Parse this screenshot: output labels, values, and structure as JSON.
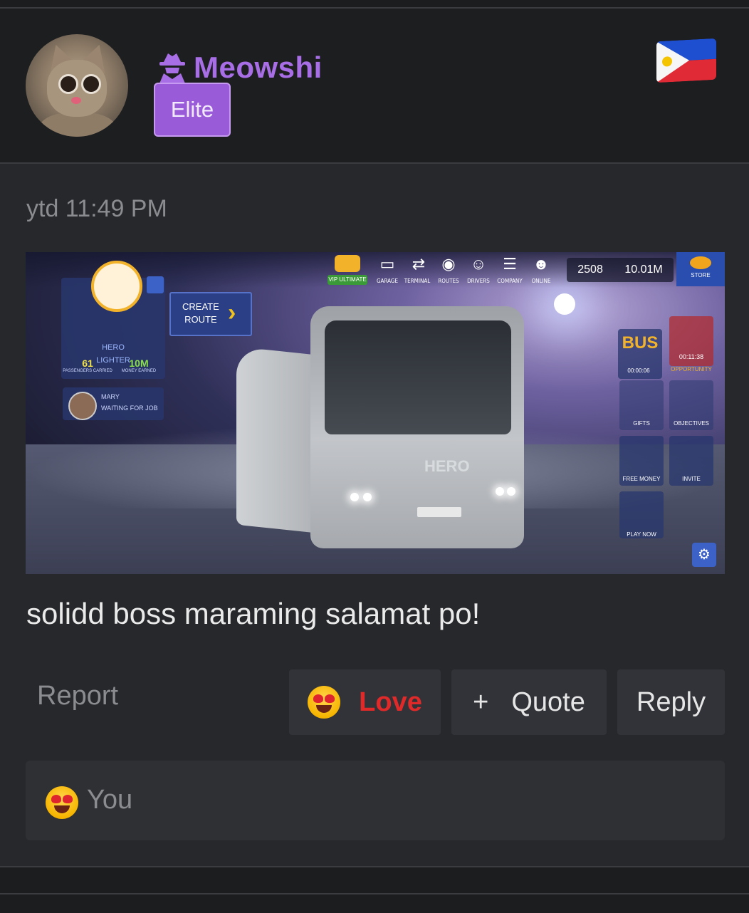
{
  "post": {
    "username": "Meowshi",
    "badge": "Elite",
    "flag": "philippines-flag",
    "timestamp": "ytd 11:49 PM",
    "message": "solidd boss maraming salamat po!"
  },
  "attachment": {
    "top_icons": [
      {
        "icon": "bus-icon",
        "label": "GARAGE"
      },
      {
        "icon": "signpost-icon",
        "label": "TERMINAL"
      },
      {
        "icon": "pin-icon",
        "label": "ROUTES"
      },
      {
        "icon": "driver-icon",
        "label": "DRIVERS"
      },
      {
        "icon": "building-icon",
        "label": "COMPANY"
      },
      {
        "icon": "people-icon",
        "label": "ONLINE"
      }
    ],
    "vip_label": "VIP ULTIMATE",
    "coins": "2508",
    "money": "10.01M",
    "store_label": "STORE",
    "player_name": "HERO",
    "player_rank": "LIGHTER",
    "passengers_value": "61",
    "passengers_label": "PASSENGERS CARRIED",
    "money_value": "10M",
    "money_label": "MONEY EARNED",
    "mary_name": "MARY",
    "mary_status": "WAITING FOR JOB",
    "create_route": "CREATE\nROUTE",
    "bus_name": "HERO",
    "tiles": [
      {
        "label": "00:00:06",
        "icon": "bus-logo"
      },
      {
        "label": "OPPORTUNITY",
        "sub": "00:11:38"
      },
      {
        "label": "GIFTS"
      },
      {
        "label": "OBJECTIVES"
      },
      {
        "label": "FREE MONEY"
      },
      {
        "label": "INVITE"
      },
      {
        "label": "PLAY NOW"
      }
    ],
    "bus_logo": "BUS"
  },
  "actions": {
    "report": "Report",
    "love": "Love",
    "quote_icon": "+",
    "quote": "Quote",
    "reply": "Reply"
  },
  "reactions": {
    "emoji": "heart-eyes-emoji",
    "label": "You"
  },
  "colors": {
    "username": "#a86ee6",
    "badge_bg": "#9a5bd8",
    "love": "#e02a2a"
  }
}
